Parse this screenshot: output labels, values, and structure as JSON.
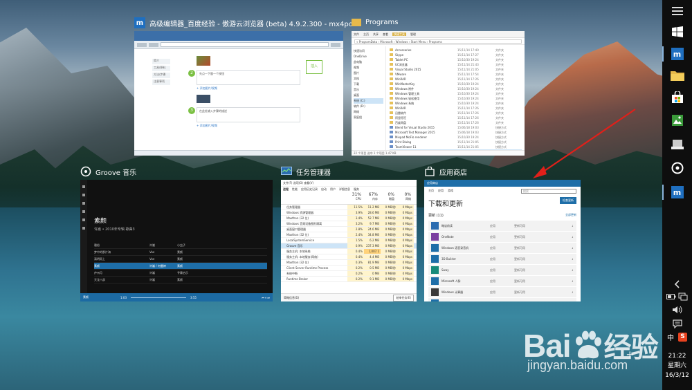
{
  "switcher": {
    "windows": [
      {
        "id": "browser",
        "title": "高级编辑器_百度经验 - 傲游云浏览器 (beta) 4.9.2.300 - mx4por...",
        "icon": "maxthon-icon"
      },
      {
        "id": "explorer",
        "title": "Programs",
        "icon": "folder-icon"
      },
      {
        "id": "groove",
        "title": "Groove 音乐",
        "icon": "groove-icon"
      },
      {
        "id": "taskmgr",
        "title": "任务管理器",
        "icon": "taskmgr-icon"
      },
      {
        "id": "store",
        "title": "应用商店",
        "icon": "store-icon"
      }
    ]
  },
  "browser": {
    "sidebar": [
      "简介",
      "工具/原料",
      "方法/步骤",
      "注意事项"
    ],
    "steps": [
      {
        "num": "2",
        "text": "先点一下窗一个按钮"
      },
      {
        "num": "3",
        "text": "在此处输入步骤的描述"
      }
    ],
    "add_link": "+ 添加图片/视频",
    "widget": "插入"
  },
  "explorer": {
    "ribbon": [
      "文件",
      "主页",
      "共享",
      "查看",
      "管理"
    ],
    "ribbon_active": "快捷工具",
    "path": "« ProgramData › Microsoft › Windows › Start Menu › Programs",
    "nav": [
      "快速访问",
      "OneDrive",
      "此电脑",
      "视频",
      "图片",
      "文档",
      "下载",
      "音乐",
      "桌面",
      "系统 (C:)",
      "软件 (D:)",
      "网络",
      "家庭组"
    ],
    "nav_selected": 9,
    "files": [
      {
        "name": "Accessories",
        "date": "15/11/14 17:40",
        "type": "文件夹"
      },
      {
        "name": "Skype",
        "date": "15/11/14 17:27",
        "type": "文件夹"
      },
      {
        "name": "Tablet PC",
        "date": "15/10/30 19:24",
        "type": "文件夹"
      },
      {
        "name": "UC浏览器",
        "date": "15/11/14 21:43",
        "type": "文件夹"
      },
      {
        "name": "Visual Studio 2015",
        "date": "15/11/14 21:05",
        "type": "文件夹"
      },
      {
        "name": "VMware",
        "date": "15/11/14 17:54",
        "type": "文件夹"
      },
      {
        "name": "WinRAR",
        "date": "15/11/14 17:26",
        "type": "文件夹"
      },
      {
        "name": "WinMasterKey",
        "date": "15/10/30 19:24",
        "type": "文件夹"
      },
      {
        "name": "Windows 附件",
        "date": "15/10/30 19:24",
        "type": "文件夹"
      },
      {
        "name": "Windows 管理工具",
        "date": "15/10/30 19:24",
        "type": "文件夹"
      },
      {
        "name": "Windows 轻松使用",
        "date": "15/10/30 19:24",
        "type": "文件夹"
      },
      {
        "name": "Windows 系统",
        "date": "15/10/30 19:24",
        "type": "文件夹"
      },
      {
        "name": "WinRAR",
        "date": "15/11/14 17:26",
        "type": "文件夹"
      },
      {
        "name": "迅雷软件",
        "date": "15/11/14 17:26",
        "type": "文件夹"
      },
      {
        "name": "阿里旺旺",
        "date": "15/11/14 17:26",
        "type": "文件夹"
      },
      {
        "name": "百度网盘",
        "date": "15/11/14 17:26",
        "type": "文件夹"
      },
      {
        "name": "Blend for Visual Studio 2015",
        "date": "15/06/18 19:03",
        "type": "快捷方式"
      },
      {
        "name": "Microsoft Test Manager 2015",
        "date": "15/06/18 19:03",
        "type": "快捷方式"
      },
      {
        "name": "Mixpad MoFlo renderer",
        "date": "15/10/30 19:24",
        "type": "快捷方式"
      },
      {
        "name": "Print Dialog",
        "date": "15/11/14 21:05",
        "type": "快捷方式"
      },
      {
        "name": "TeamViewer 11",
        "date": "15/11/14 21:05",
        "type": "快捷方式"
      },
      {
        "name": "Visual Studio 2015",
        "date": "15/06/18 19:03",
        "type": "快捷方式"
      }
    ],
    "status": "22 个项目   选中 1 个项目 1.47 KB"
  },
  "groove": {
    "album_title": "素颜",
    "album_sub": "许嵩 • 2010年专辑 歌曲3",
    "tracks": [
      {
        "title": "雅俗",
        "artist": "许嵩",
        "album": "小虫子"
      },
      {
        "title": "梦中的那片海",
        "artist": "Vae",
        "album": "素颜"
      },
      {
        "title": "清明雨上",
        "artist": "Vae",
        "album": "素颜"
      },
      {
        "title": "素颜",
        "artist": "许嵩 / 何曼婷",
        "album": "素颜"
      },
      {
        "title": "庐州月",
        "artist": "许嵩",
        "album": "寻雾启示"
      },
      {
        "title": "天龙八部",
        "artist": "许嵩",
        "album": "素颜"
      }
    ],
    "selected_track": 3,
    "player": {
      "now": "素颜",
      "time_start": "1:03",
      "time_end": "3:55"
    }
  },
  "taskmgr": {
    "menu": "文件(F)  选项(O)  查看(V)",
    "tabs": [
      "进程",
      "性能",
      "应用历史记录",
      "启动",
      "用户",
      "详细信息",
      "服务"
    ],
    "headers": {
      "cpu": "31%",
      "mem": "67%",
      "disk": "0%",
      "net": "0%"
    },
    "header_labels": {
      "cpu": "CPU",
      "mem": "内存",
      "disk": "磁盘",
      "net": "网络"
    },
    "processes": [
      {
        "name": "任务管理器",
        "cpu": "11.5%",
        "mem": "11.2 MB",
        "disk": "0 MB/秒",
        "net": "0 Mbps"
      },
      {
        "name": "Windows 资源管理器",
        "cpu": "3.9%",
        "mem": "28.6 MB",
        "disk": "0 MB/秒",
        "net": "0 Mbps"
      },
      {
        "name": "Maxthon (32 位)",
        "cpu": "3.4%",
        "mem": "52.7 MB",
        "disk": "0 MB/秒",
        "net": "0 Mbps"
      },
      {
        "name": "Windows 音频设备图形隔离",
        "cpu": "3.2%",
        "mem": "9.7 MB",
        "disk": "0 MB/秒",
        "net": "0 Mbps"
      },
      {
        "name": "桌面窗口管理器",
        "cpu": "2.8%",
        "mem": "24.6 MB",
        "disk": "0 MB/秒",
        "net": "0 Mbps"
      },
      {
        "name": "Maxthon (32 位)",
        "cpu": "2.4%",
        "mem": "34.8 MB",
        "disk": "0 MB/秒",
        "net": "0 Mbps"
      },
      {
        "name": "LocalSystemService",
        "cpu": "1.5%",
        "mem": "6.2 MB",
        "disk": "0 MB/秒",
        "net": "0 Mbps"
      },
      {
        "name": "Groove 音乐",
        "cpu": "0.9%",
        "mem": "237.3 MB",
        "disk": "0 MB/秒",
        "net": "0 Mbps"
      },
      {
        "name": "服务主机: 本地系统",
        "cpu": "0.4%",
        "mem": "1,007.1 MB",
        "disk": "0 MB/秒",
        "net": "0 Mbps"
      },
      {
        "name": "服务主机: 本地服务(网络)",
        "cpu": "0.4%",
        "mem": "4.4 MB",
        "disk": "0 MB/秒",
        "net": "0 Mbps"
      },
      {
        "name": "Maxthon (32 位)",
        "cpu": "0.3%",
        "mem": "81.9 MB",
        "disk": "0 MB/秒",
        "net": "0 Mbps"
      },
      {
        "name": "Client Server Runtime Process",
        "cpu": "0.2%",
        "mem": "0.5 MB",
        "disk": "0 MB/秒",
        "net": "0 Mbps"
      },
      {
        "name": "系统中断",
        "cpu": "0.2%",
        "mem": "0 MB",
        "disk": "0 MB/秒",
        "net": "0 Mbps"
      },
      {
        "name": "Runtime Broker",
        "cpu": "0.2%",
        "mem": "9.1 MB",
        "disk": "0 MB/秒",
        "net": "0 Mbps"
      }
    ],
    "selected_process": 7,
    "foot_left": "简略信息(D)",
    "foot_btn": "结束任务(E)"
  },
  "store": {
    "bar_title": "应用商店",
    "nav": [
      "主页",
      "应用",
      "游戏"
    ],
    "search_placeholder": "搜索",
    "heading": "下载和更新",
    "update_btn": "检查更新",
    "sub_title": "更新 (11)",
    "sub_link": "全部更新",
    "apps": [
      {
        "name": "略谈前读",
        "type": "应用",
        "status": "更新可用",
        "color": "#2b6cb0"
      },
      {
        "name": "OneNote",
        "type": "应用",
        "status": "更新可用",
        "color": "#7b3fa0"
      },
      {
        "name": "Windows 语音录音机",
        "type": "应用",
        "status": "更新可用",
        "color": "#1e6ea8"
      },
      {
        "name": "3D Builder",
        "type": "应用",
        "status": "更新可用",
        "color": "#1e6ea8"
      },
      {
        "name": "Sway",
        "type": "应用",
        "status": "更新可用",
        "color": "#178a7a"
      },
      {
        "name": "Microsoft 人脉",
        "type": "应用",
        "status": "更新可用",
        "color": "#1e6ea8"
      },
      {
        "name": "Windows 计算器",
        "type": "应用",
        "status": "更新可用",
        "color": "#3a3a3a"
      },
      {
        "name": "Microsoft 电话",
        "type": "应用",
        "status": "更新可用",
        "color": "#1e6ea8"
      }
    ]
  },
  "taskbar": {
    "time": "21:22",
    "weekday": "星期六",
    "date": "16/3/12",
    "ime": "中",
    "s_badge": "S",
    "pins": [
      "menu-icon",
      "start-icon",
      "maxthon-pin-icon",
      "folder-pin-icon",
      "store-pin-icon",
      "photo-pin-icon",
      "tablet-pin-icon",
      "groove-pin-icon",
      "maxthon-pin-icon-2"
    ]
  },
  "watermark": {
    "brand": "Bai",
    "brand2": "经验",
    "url": "jingyan.baidu.com"
  },
  "colors": {
    "accent": "#1e6ea8",
    "arrow": "#e0201a",
    "taskbar": "#0e0e0e"
  }
}
